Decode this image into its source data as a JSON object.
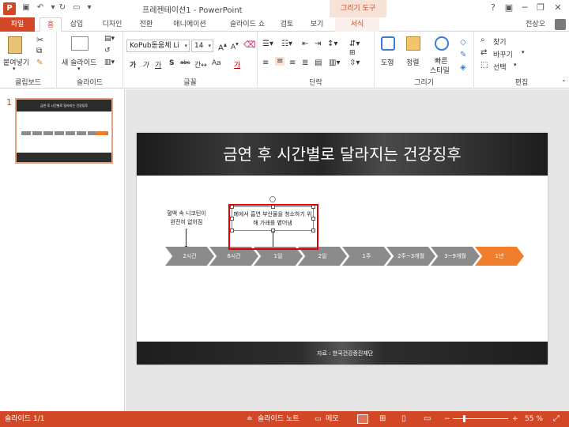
{
  "titlebar": {
    "app_icon": "P",
    "title": "프레젠테이션1 - PowerPoint",
    "context_tool": "그리기 도구",
    "help": "?",
    "minimize": "─",
    "restore": "❐",
    "close": "✕"
  },
  "tabs": {
    "file": "파일",
    "home": "홈",
    "insert": "삽입",
    "design": "디자인",
    "transitions": "전환",
    "animations": "애니메이션",
    "slideshow": "슬라이드 쇼",
    "review": "검토",
    "view": "보기",
    "format": "서식",
    "account": "전상오"
  },
  "ribbon": {
    "clipboard": {
      "paste": "붙여넣기",
      "label": "클립보드"
    },
    "slides": {
      "new_slide": "새 슬라이드",
      "label": "슬라이드"
    },
    "font": {
      "font_name": "KoPub돋움체 Li",
      "font_size": "14",
      "label": "글꼴",
      "buttons": [
        "가",
        "가",
        "가",
        "S",
        "abc",
        "간↔",
        "Aa",
        "가"
      ]
    },
    "paragraph": {
      "label": "단락"
    },
    "drawing": {
      "shapes": "도형",
      "arrange": "정렬",
      "quick_styles_1": "빠른",
      "quick_styles_2": "스타일",
      "label": "그리기"
    },
    "editing": {
      "find": "찾기",
      "replace": "바꾸기",
      "select": "선택",
      "label": "편집"
    }
  },
  "thumbnail": {
    "number": "1",
    "title": "금연 후 시간별로 달라지는 건강징후"
  },
  "slide": {
    "title": "금연 후 시간별로 달라지는 건강징후",
    "note_left": "혈액 속 니코틴이 완전히 없어짐",
    "textbox": "폐에서 흡연 부산물을 청소하기 위해 가래를 뱉어냄",
    "timeline": [
      "2시간",
      "6시간",
      "1일",
      "2일",
      "1주",
      "2주~3개월",
      "3~9개월",
      "1년"
    ],
    "source": "자료 : 한국건강증진재단"
  },
  "statusbar": {
    "slide_info": "슬라이드 1/1",
    "notes": "슬라이드 노트",
    "comments": "메모",
    "zoom_minus": "−",
    "zoom_plus": "+",
    "zoom": "55 %"
  },
  "colors": {
    "accent": "#d24726",
    "timeline_gray": "#8b8b8b",
    "timeline_highlight": "#ef7d2a",
    "selection_red": "#e00000"
  }
}
